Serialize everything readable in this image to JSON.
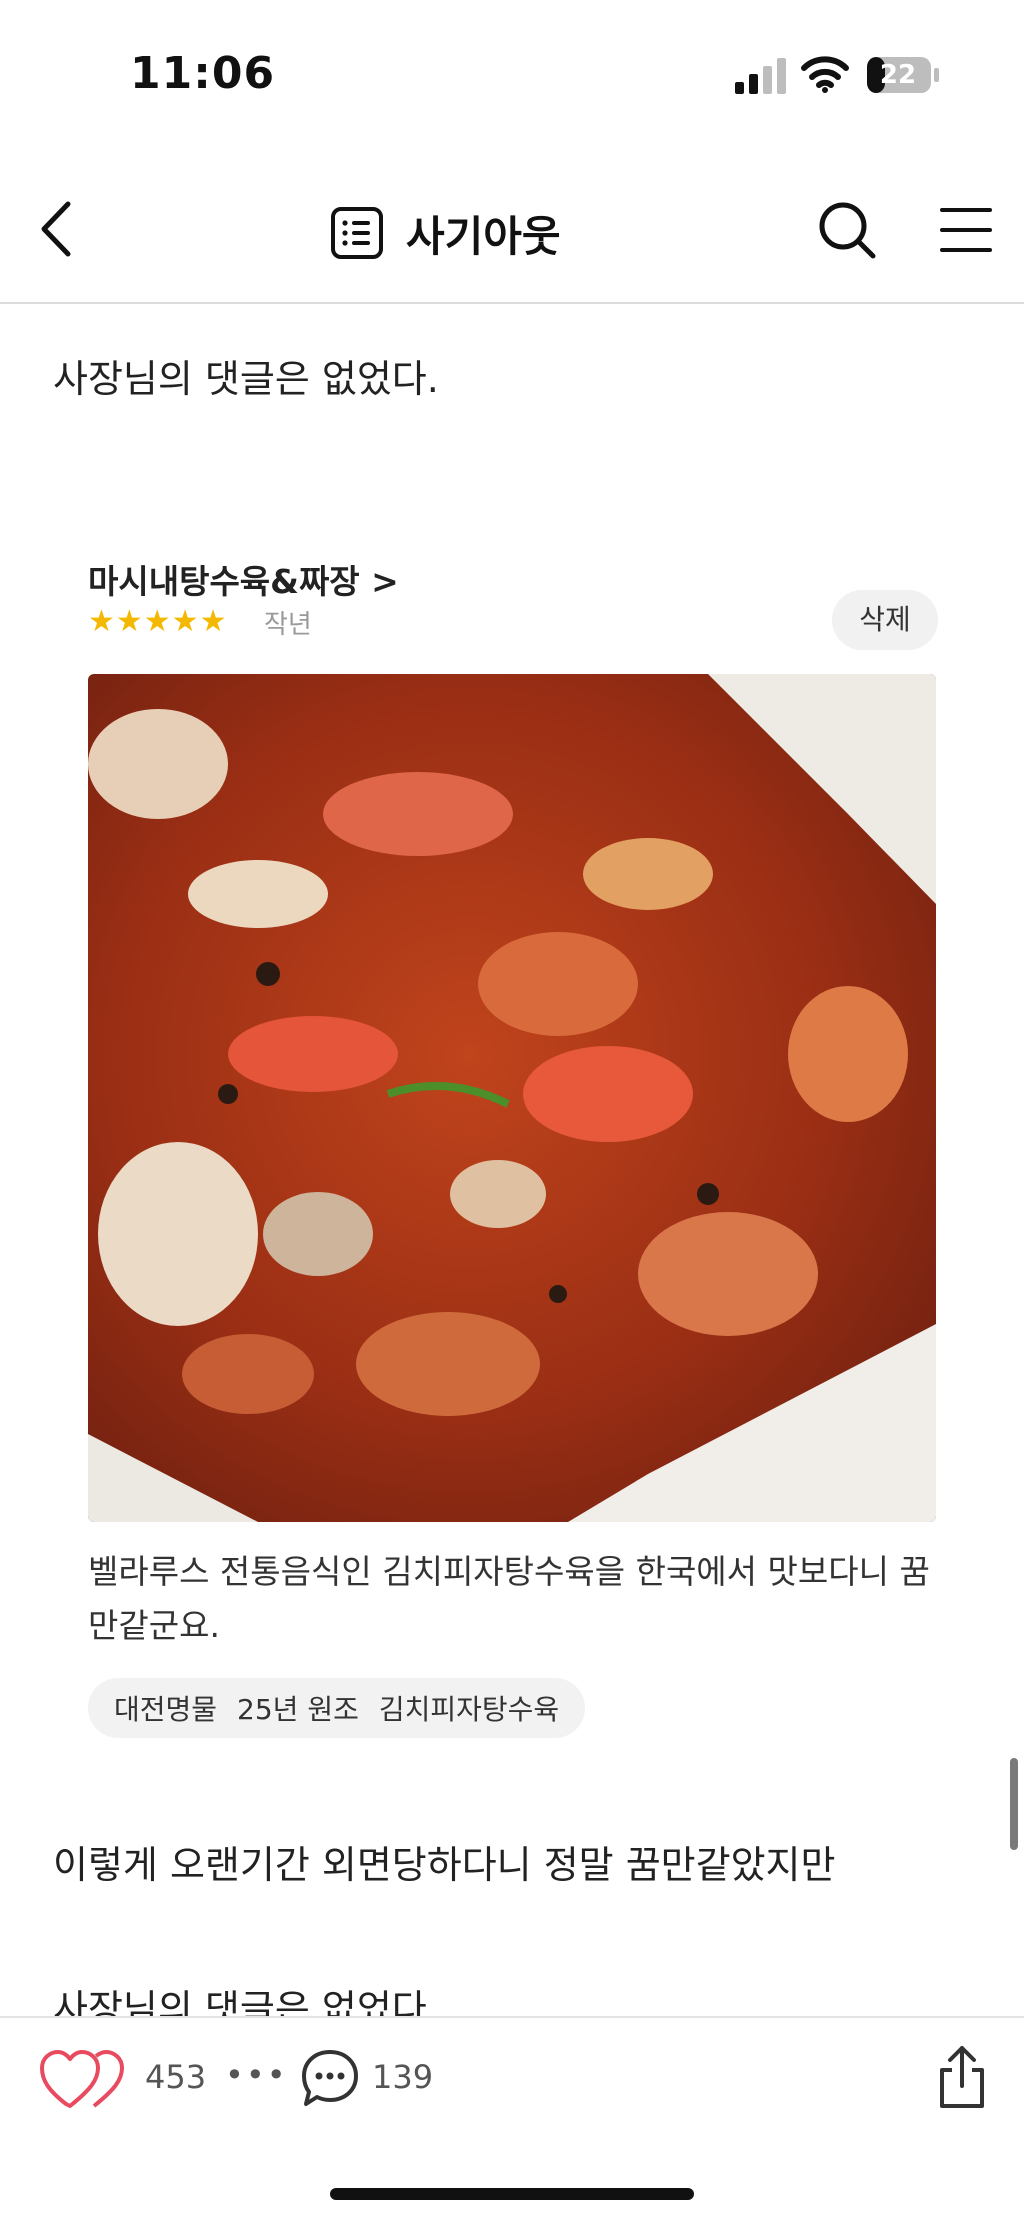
{
  "status_bar": {
    "time": "11:06",
    "battery": "22"
  },
  "header": {
    "title": "사기아웃"
  },
  "body": {
    "para1": "사장님의 댓글은 없었다.",
    "para2": "이렇게 오랜기간 외면당하다니 정말 꿈만같았지만",
    "para3": "사장님의 댓글은 없었다."
  },
  "review": {
    "shop_name": "마시내탕수육&짜장 >",
    "stars": "★★★★★",
    "rating": 5,
    "date": "작년",
    "delete_label": "삭제",
    "text": "벨라루스 전통음식인 김치피자탕수육을 한국에서 맛보다니 꿈만같군요.",
    "tags": [
      "대전명물",
      "25년 원조",
      "김치피자탕수육"
    ]
  },
  "bottom_bar": {
    "like_count": "453",
    "more": "•••",
    "comment_count": "139"
  }
}
